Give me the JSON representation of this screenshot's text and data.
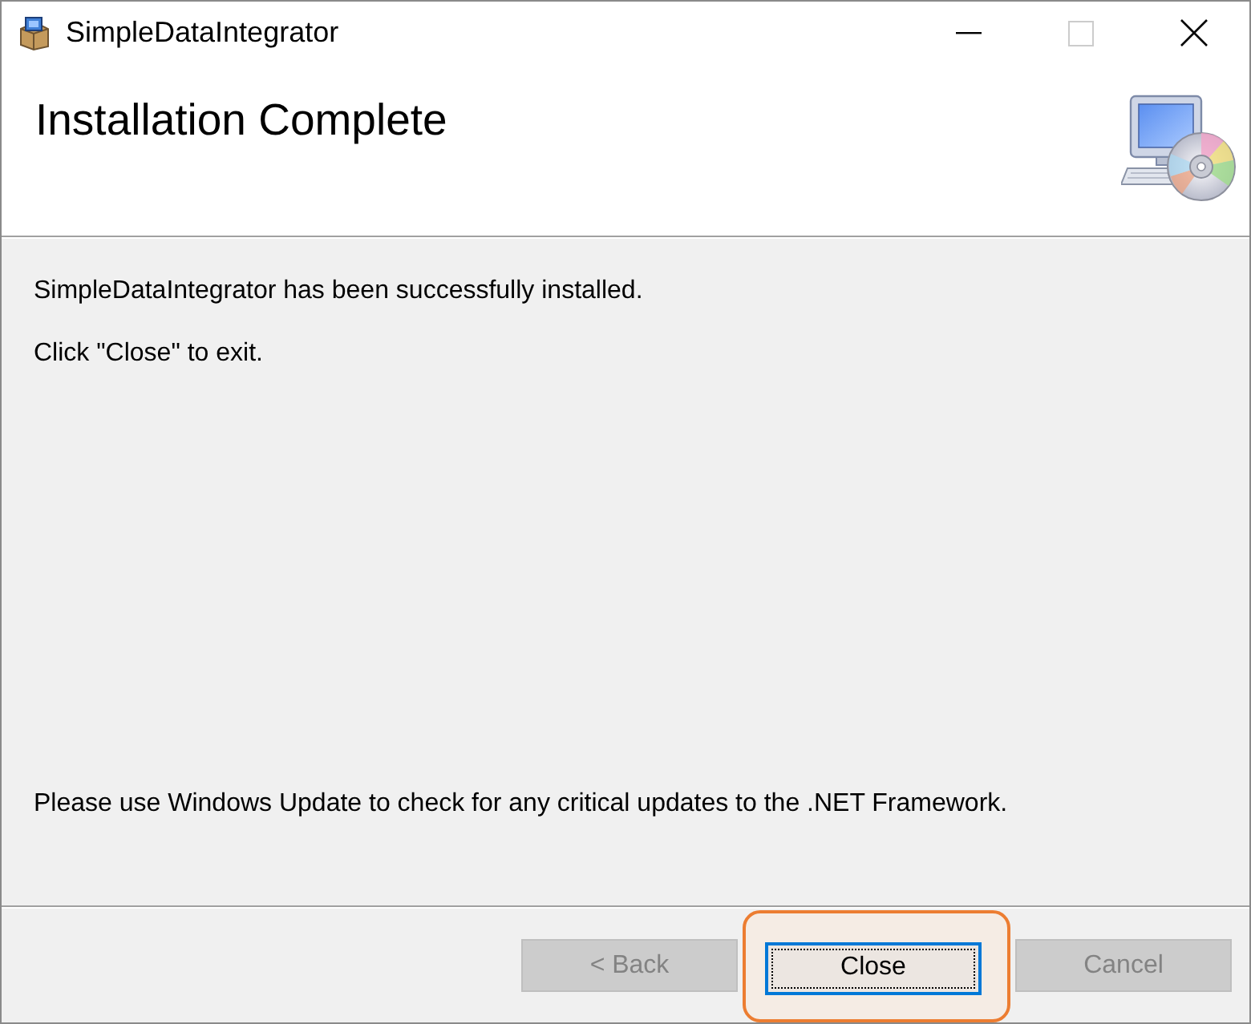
{
  "window": {
    "title": "SimpleDataIntegrator",
    "controls": [
      {
        "kind": "minimize",
        "disabled": false
      },
      {
        "kind": "maximize",
        "disabled": true
      },
      {
        "kind": "close",
        "disabled": false
      }
    ]
  },
  "header": {
    "title": "Installation Complete"
  },
  "body": {
    "messages": [
      "SimpleDataIntegrator has been successfully installed.",
      "Click \"Close\" to exit."
    ],
    "note": "Please use Windows Update to check for any critical updates to the .NET Framework."
  },
  "buttons": [
    {
      "label": "< Back",
      "disabled": true,
      "focused": false,
      "highlighted": false
    },
    {
      "label": "Close",
      "disabled": false,
      "focused": true,
      "highlighted": true
    },
    {
      "label": "Cancel",
      "disabled": true,
      "focused": false,
      "highlighted": false
    }
  ]
}
